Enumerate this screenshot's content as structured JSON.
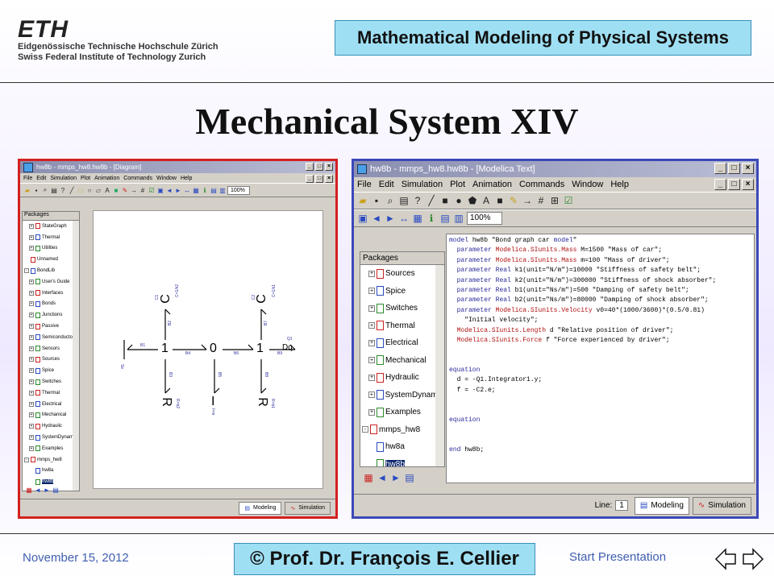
{
  "header": {
    "logo_text": "ETH",
    "logo_line1": "Eidgenössische Technische Hochschule Zürich",
    "logo_line2": "Swiss Federal Institute of Technology Zurich",
    "course_title": "Mathematical Modeling of Physical Systems"
  },
  "slide_title": "Mechanical System XIV",
  "footer": {
    "date": "November 15, 2012",
    "author": "© Prof. Dr. François E. Cellier",
    "start": "Start Presentation"
  },
  "left_window": {
    "title": "hw8b - mmps_hw8.hw8b - [Diagram]",
    "menu": [
      "File",
      "Edit",
      "Simulation",
      "Plot",
      "Animation",
      "Commands",
      "Window",
      "Help"
    ],
    "zoom": "100%",
    "tree_header": "Packages",
    "tree_items": [
      {
        "label": "StateGraph",
        "indent": 1,
        "expander": "+"
      },
      {
        "label": "Thermal",
        "indent": 1,
        "expander": "+"
      },
      {
        "label": "Utilities",
        "indent": 1,
        "expander": "+"
      },
      {
        "label": "Unnamed",
        "indent": 0,
        "expander": ""
      },
      {
        "label": "BondLib",
        "indent": 0,
        "expander": "-"
      },
      {
        "label": "User's Guide",
        "indent": 1,
        "expander": "+"
      },
      {
        "label": "Interfaces",
        "indent": 1,
        "expander": "+"
      },
      {
        "label": "Bonds",
        "indent": 1,
        "expander": "+"
      },
      {
        "label": "Junctions",
        "indent": 1,
        "expander": "+"
      },
      {
        "label": "Passive",
        "indent": 1,
        "expander": "+"
      },
      {
        "label": "Semiconductors",
        "indent": 1,
        "expander": "+"
      },
      {
        "label": "Sensors",
        "indent": 1,
        "expander": "+"
      },
      {
        "label": "Sources",
        "indent": 1,
        "expander": "+"
      },
      {
        "label": "Spice",
        "indent": 1,
        "expander": "+"
      },
      {
        "label": "Switches",
        "indent": 1,
        "expander": "+"
      },
      {
        "label": "Thermal",
        "indent": 1,
        "expander": "+"
      },
      {
        "label": "Electrical",
        "indent": 1,
        "expander": "+"
      },
      {
        "label": "Mechanical",
        "indent": 1,
        "expander": "+"
      },
      {
        "label": "Hydraulic",
        "indent": 1,
        "expander": "+"
      },
      {
        "label": "SystemDynam...",
        "indent": 1,
        "expander": "+"
      },
      {
        "label": "Examples",
        "indent": 1,
        "expander": "+"
      },
      {
        "label": "mmps_hw8",
        "indent": 0,
        "expander": "-"
      },
      {
        "label": "hw8a",
        "indent": 1,
        "expander": ""
      },
      {
        "label": "hw8b",
        "indent": 1,
        "expander": "",
        "selected": true
      }
    ],
    "diagram": {
      "junction_1a": "1",
      "junction_0": "0",
      "junction_1b": "1",
      "cap1_label": "C",
      "cap2_label": "C",
      "r1_label": "R",
      "r2_label": "R",
      "i_label": "I",
      "dq_label": "Dq",
      "source_label": "|",
      "se_label": "Se",
      "cap1_param": "C=1/k2",
      "cap2_param": "C=1/k1",
      "cap1_name": "C1",
      "cap2_name": "C2",
      "r1_param": "R=b2",
      "r2_param": "R=b1",
      "i_param": "I=m",
      "dq_name": "Q1",
      "b_labels": [
        "B1",
        "B2",
        "B3",
        "B4",
        "B5",
        "B6",
        "B7",
        "B8",
        "B9"
      ]
    },
    "tabs": {
      "modeling": "Modeling",
      "simulation": "Simulation"
    }
  },
  "right_window": {
    "title": "hw8b - mmps_hw8.hw8b - [Modelica Text]",
    "menu": [
      "File",
      "Edit",
      "Simulation",
      "Plot",
      "Animation",
      "Commands",
      "Window",
      "Help"
    ],
    "zoom": "100%",
    "tree_header": "Packages",
    "tree_items": [
      {
        "label": "Sources",
        "indent": 1,
        "expander": "+"
      },
      {
        "label": "Spice",
        "indent": 1,
        "expander": "+"
      },
      {
        "label": "Switches",
        "indent": 1,
        "expander": "+"
      },
      {
        "label": "Thermal",
        "indent": 1,
        "expander": "+"
      },
      {
        "label": "Electrical",
        "indent": 1,
        "expander": "+"
      },
      {
        "label": "Mechanical",
        "indent": 1,
        "expander": "+"
      },
      {
        "label": "Hydraulic",
        "indent": 1,
        "expander": "+"
      },
      {
        "label": "SystemDynam...",
        "indent": 1,
        "expander": "+"
      },
      {
        "label": "Examples",
        "indent": 1,
        "expander": "+"
      },
      {
        "label": "mmps_hw8",
        "indent": 0,
        "expander": "-"
      },
      {
        "label": "hw8a",
        "indent": 1,
        "expander": ""
      },
      {
        "label": "hw8b",
        "indent": 1,
        "expander": "",
        "selected": true
      }
    ],
    "code_lines": [
      "model hw8b \"Bond graph car model\"",
      "  parameter Modelica.SIunits.Mass M=1500 \"Mass of car\";",
      "  parameter Modelica.SIunits.Mass m=100 \"Mass of driver\";",
      "  parameter Real k1(unit=\"N/m\")=10000 \"Stiffness of safety belt\";",
      "  parameter Real k2(unit=\"N/m\")=300000 \"Stiffness of shock absorber\";",
      "  parameter Real b1(unit=\"Ns/m\")=500 \"Damping of safety belt\";",
      "  parameter Real b2(unit=\"Ns/m\")=80000 \"Damping of shock absorber\";",
      "  parameter Modelica.SIunits.Velocity v0=40*(1000/3600)*(0.5/0.81)",
      "    \"Initial velocity\";",
      "  Modelica.SIunits.Length d \"Relative position of driver\";",
      "  Modelica.SIunits.Force f \"Force experienced by driver\";",
      "",
      "",
      "equation",
      "  d = -Q1.Integrator1.y;",
      "  f = -C2.e;",
      "",
      "",
      "equation",
      "",
      "",
      "end hw8b;"
    ],
    "status_line_label": "Line:",
    "status_line_value": "1",
    "tabs": {
      "modeling": "Modeling",
      "simulation": "Simulation"
    }
  },
  "colors": {
    "left_frame": "#d42020",
    "right_frame": "#3b49b8",
    "title_box": "#9fdff3",
    "footer_text": "#3f5fb0"
  }
}
